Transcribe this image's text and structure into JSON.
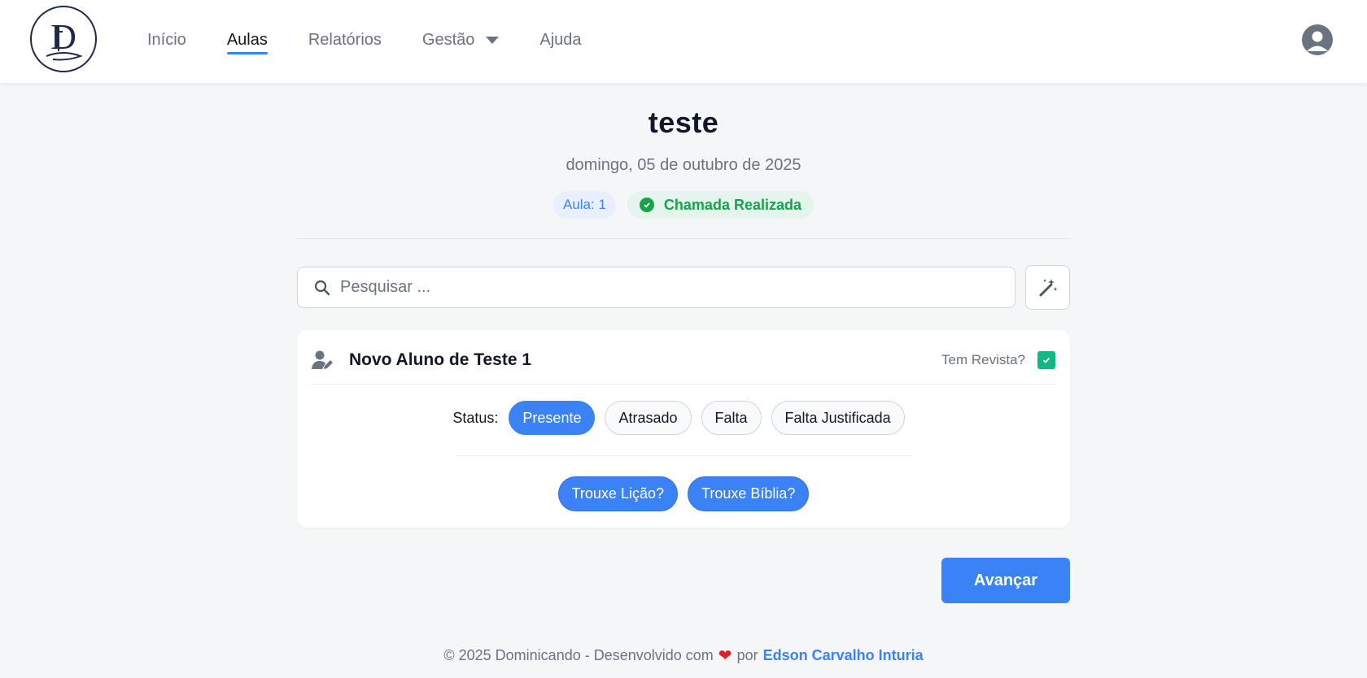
{
  "header": {
    "logo_letter": "D",
    "nav": [
      {
        "label": "Início",
        "active": false
      },
      {
        "label": "Aulas",
        "active": true
      },
      {
        "label": "Relatórios",
        "active": false
      },
      {
        "label": "Gestão",
        "active": false,
        "has_dropdown": true
      },
      {
        "label": "Ajuda",
        "active": false
      }
    ],
    "user_icon": "user-circle-icon"
  },
  "lesson": {
    "title": "teste",
    "date": "domingo, 05 de outubro de 2025",
    "aula_badge": "Aula: 1",
    "chamada_badge": "Chamada Realizada"
  },
  "search": {
    "placeholder": "Pesquisar ...",
    "value": "",
    "magic_icon": "magic-wand-icon"
  },
  "student": {
    "name": "Novo Aluno de Teste 1",
    "revista_label": "Tem Revista?",
    "revista_checked": true,
    "status_label": "Status:",
    "status_options": [
      "Presente",
      "Atrasado",
      "Falta",
      "Falta Justificada"
    ],
    "status_selected": "Presente",
    "licao_label": "Trouxe Lição?",
    "biblia_label": "Trouxe Bíblia?"
  },
  "actions": {
    "next_label": "Avançar"
  },
  "footer": {
    "copyright": "© 2025 Dominicando - Desenvolvido com",
    "heart": "❤",
    "por": "por",
    "author": "Edson Carvalho Inturia"
  },
  "colors": {
    "accent": "#3b82f6",
    "success": "#16a34a",
    "checkbox": "#10b981",
    "background": "#f5f6f8"
  }
}
